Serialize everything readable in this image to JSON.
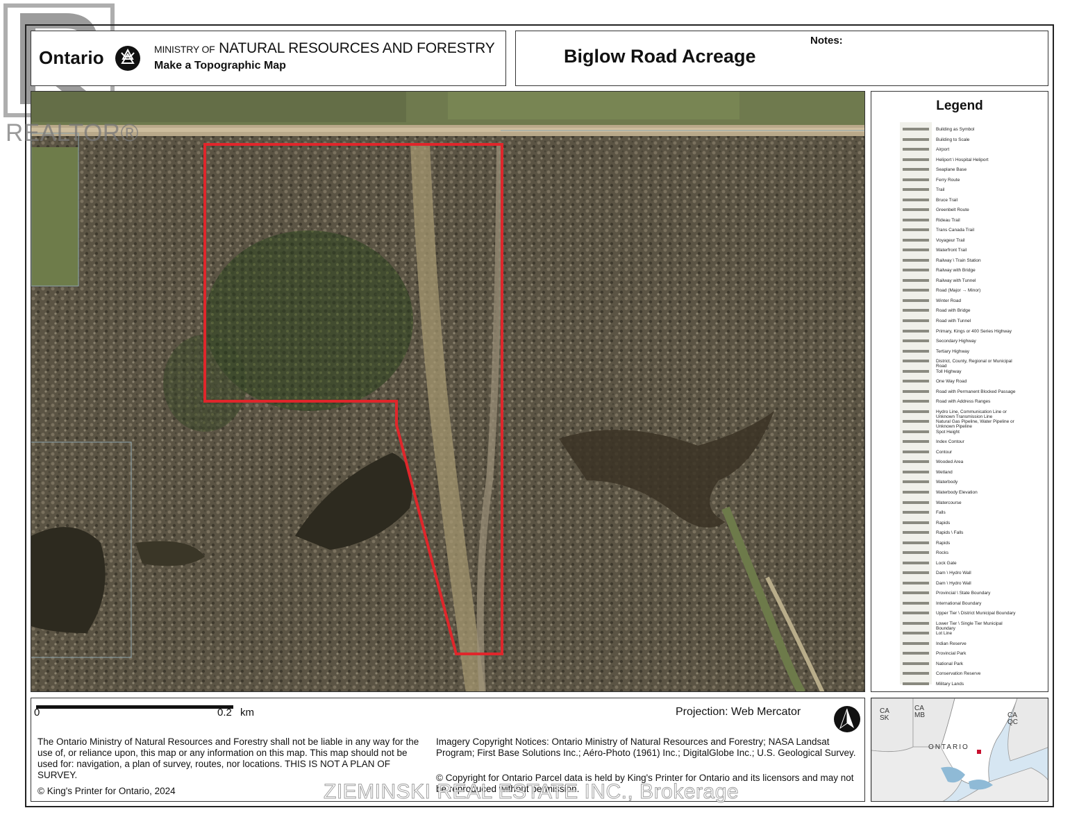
{
  "header": {
    "brand": "Ontario",
    "ministry_prefix": "MINISTRY OF",
    "ministry_name": "NATURAL RESOURCES AND FORESTRY",
    "subtitle": "Make a Topographic Map",
    "map_title": "Biglow Road Acreage",
    "notes_label": "Notes:"
  },
  "legend": {
    "title": "Legend",
    "items": [
      "Building as Symbol",
      "Building to Scale",
      "Airport",
      "Heliport \\ Hospital Heliport",
      "Seaplane Base",
      "Ferry Route",
      "Trail",
      "Bruce Trail",
      "Greenbelt Route",
      "Rideau Trail",
      "Trans Canada Trail",
      "Voyageur Trail",
      "Waterfront Trail",
      "Railway \\ Train Station",
      "Railway with Bridge",
      "Railway with Tunnel",
      "Road (Major → Minor)",
      "Winter Road",
      "Road with Bridge",
      "Road with Tunnel",
      "Primary, Kings or 400 Series Highway",
      "Secondary Highway",
      "Tertiary Highway",
      "District, County, Regional or Municipal Road",
      "Toll Highway",
      "One Way Road",
      "Road with Permanent Blocked Passage",
      "Road with Address Ranges",
      "Hydro Line, Communication Line or Unknown Transmission Line",
      "Natural Gas Pipeline, Water Pipeline or Unknown Pipeline",
      "Spot Height",
      "Index Contour",
      "Contour",
      "Wooded Area",
      "Wetland",
      "Waterbody",
      "Waterbody Elevation",
      "Watercourse",
      "Falls",
      "Rapids",
      "Rapids \\ Falls",
      "Rapids",
      "Rocks",
      "Lock Gate",
      "Dam \\ Hydro Wall",
      "Dam \\ Hydro Wall",
      "Provincial \\ State Boundary",
      "International Boundary",
      "Upper Tier \\ District Municipal Boundary",
      "Lower Tier \\ Single Tier Municipal Boundary",
      "Lot Line",
      "Indian Reserve",
      "Provincial Park",
      "National Park",
      "Conservation Reserve",
      "Military Lands"
    ]
  },
  "scale": {
    "zero": "0",
    "mark": "0.2",
    "unit": "km"
  },
  "projection": "Projection: Web Mercator",
  "disclaimer": "The Ontario Ministry of Natural Resources and Forestry shall not be liable in any way for the use of, or reliance upon, this map or any information on this map.  This map should not be used for: navigation, a plan of survey, routes, nor locations. THIS IS NOT A PLAN OF SURVEY.",
  "copyright_left": "© King's Printer for Ontario,  2024",
  "imagery_notice": "Imagery Copyright Notices: Ontario Ministry of Natural Resources and Forestry; NASA Landsat Program; First Base Solutions Inc.; Aéro-Photo (1961) Inc.; DigitalGlobe Inc.; U.S. Geological Survey.",
  "copyright_right": "© Copyright for Ontario Parcel data is held by King's Printer for Ontario and its licensors and may not be reproduced without permission.",
  "inset": {
    "labels": [
      "CA SK",
      "CA MB",
      "CA QC",
      "ONTARIO"
    ]
  },
  "watermark": "ZIEMINSKI REAL ESTATE INC., Brokerage",
  "realtor_watermark": "REALTOR®",
  "colors": {
    "parcel_outline": "#e0262b",
    "forest": "#5a5342",
    "water": "#2d2a1f"
  }
}
